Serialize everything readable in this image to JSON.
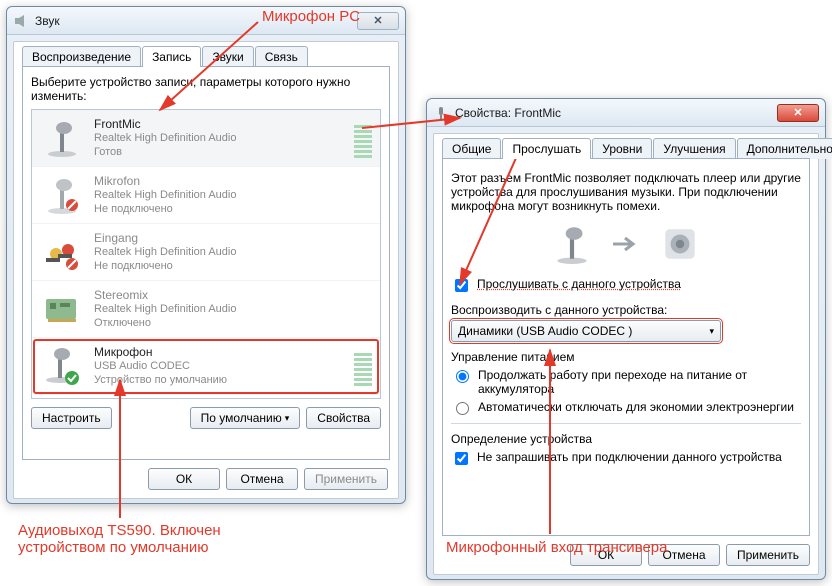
{
  "annotations": {
    "top": "Микрофон PC",
    "bottom_left": "Аудиовыход TS590. Включен\nустройством по умолчанию",
    "bottom_right": "Микрофонный вход трансивера"
  },
  "sound_window": {
    "title": "Звук",
    "tabs": [
      "Воспроизведение",
      "Запись",
      "Звуки",
      "Связь"
    ],
    "instruction": "Выберите устройство записи, параметры которого нужно\nизменить:",
    "devices": [
      {
        "name": "FrontMic",
        "driver": "Realtek High Definition Audio",
        "status": "Готов"
      },
      {
        "name": "Mikrofon",
        "driver": "Realtek High Definition Audio",
        "status": "Не подключено"
      },
      {
        "name": "Eingang",
        "driver": "Realtek High Definition Audio",
        "status": "Не подключено"
      },
      {
        "name": "Stereomix",
        "driver": "Realtek High Definition Audio",
        "status": "Отключено"
      },
      {
        "name": "Микрофон",
        "driver": "USB Audio CODEC",
        "status": "Устройство по умолчанию"
      }
    ],
    "buttons": {
      "configure": "Настроить",
      "default": "По умолчанию",
      "properties": "Свойства"
    },
    "footer": {
      "ok": "ОК",
      "cancel": "Отмена",
      "apply": "Применить"
    }
  },
  "props_window": {
    "title": "Свойства: FrontMic",
    "tabs": [
      "Общие",
      "Прослушать",
      "Уровни",
      "Улучшения",
      "Дополнительно"
    ],
    "desc": "Этот разъем FrontMic позволяет подключать плеер или другие устройства для прослушивания музыки. При подключении микрофона могут возникнуть помехи.",
    "listen_checkbox": "Прослушивать с данного устройства",
    "playback_label": "Воспроизводить с данного устройства:",
    "playback_value": "Динамики (USB Audio CODEC )",
    "power_group": "Управление питанием",
    "radio1": "Продолжать работу при переходе на питание от аккумулятора",
    "radio2": "Автоматически отключать для экономии электроэнергии",
    "detect_group": "Определение устройства",
    "detect_checkbox": "Не запрашивать при подключении данного устройства",
    "footer": {
      "ok": "ОК",
      "cancel": "Отмена",
      "apply": "Применить"
    }
  }
}
